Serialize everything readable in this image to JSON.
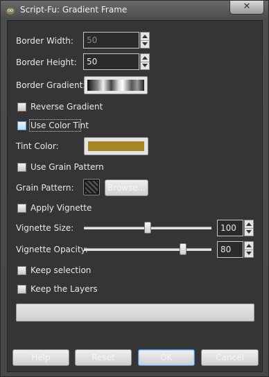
{
  "window": {
    "title": "Script-Fu: Gradient Frame",
    "close_label": "✕"
  },
  "fields": {
    "border_width": {
      "label": "Border Width:",
      "value": "50",
      "enabled": false
    },
    "border_height": {
      "label": "Border Height:",
      "value": "50",
      "enabled": true
    },
    "border_gradient": {
      "label": "Border Gradient:"
    },
    "reverse_gradient": {
      "label": "Reverse Gradient",
      "checked": false
    },
    "use_color_tint": {
      "label": "Use Color Tint",
      "checked": false,
      "focused": true
    },
    "tint_color": {
      "label": "Tint Color:",
      "color": "#a68526"
    },
    "use_grain_pattern": {
      "label": "Use Grain Pattern",
      "checked": false
    },
    "grain_pattern": {
      "label": "Grain Pattern:",
      "browse_label": "Browse..."
    },
    "apply_vignette": {
      "label": "Apply Vignette",
      "checked": false
    },
    "vignette_size": {
      "label": "Vignette Size:",
      "value": "100"
    },
    "vignette_opacity": {
      "label": "Vignette Opacity:",
      "value": "80"
    },
    "keep_selection": {
      "label": "Keep selection",
      "checked": false
    },
    "keep_layers": {
      "label": "Keep the Layers",
      "checked": false
    }
  },
  "buttons": {
    "help": "Help",
    "reset": "Reset",
    "ok": "OK",
    "cancel": "Cancel"
  },
  "colors": {
    "tint": "#a68526",
    "focus_highlight": "#5a9bd5"
  },
  "icons": {
    "app": "gimp-icon",
    "close": "close-icon"
  }
}
